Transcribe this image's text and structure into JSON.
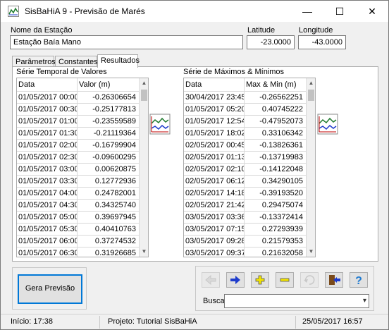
{
  "window": {
    "title": "SisBaHiA 9 - Previsão de Marés",
    "minimize": "—",
    "maximize": "☐",
    "close": "✕"
  },
  "station": {
    "name_label": "Nome da Estação",
    "name_value": "Estação Baía Mano",
    "lat_label": "Latitude",
    "lat_value": "-23.0000",
    "lon_label": "Longitude",
    "lon_value": "-43.0000"
  },
  "tabs": [
    {
      "label": "Parâmetros"
    },
    {
      "label": "Constantes"
    },
    {
      "label": "Resultados"
    }
  ],
  "series": {
    "title": "Série Temporal de Valores",
    "col1": "Data",
    "col2": "Valor (m)",
    "rows": [
      [
        "01/05/2017 00:00",
        "-0.26306654"
      ],
      [
        "01/05/2017 00:30",
        "-0.25177813"
      ],
      [
        "01/05/2017 01:00",
        "-0.23559589"
      ],
      [
        "01/05/2017 01:30",
        "-0.21119364"
      ],
      [
        "01/05/2017 02:00",
        "-0.16799904"
      ],
      [
        "01/05/2017 02:30",
        "-0.09600295"
      ],
      [
        "01/05/2017 03:00",
        "0.00620875"
      ],
      [
        "01/05/2017 03:30",
        "0.12772936"
      ],
      [
        "01/05/2017 04:00",
        "0.24782001"
      ],
      [
        "01/05/2017 04:30",
        "0.34325740"
      ],
      [
        "01/05/2017 05:00",
        "0.39697945"
      ],
      [
        "01/05/2017 05:30",
        "0.40410763"
      ],
      [
        "01/05/2017 06:00",
        "0.37274532"
      ],
      [
        "01/05/2017 06:30",
        "0.31926685"
      ]
    ]
  },
  "extremes": {
    "title": "Série de Máximos & Mínimos",
    "col1": "Data",
    "col2": "Max & Min (m)",
    "rows": [
      [
        "30/04/2017 23:45",
        "-0.26562251"
      ],
      [
        "01/05/2017 05:20",
        "0.40745222"
      ],
      [
        "01/05/2017 12:54",
        "-0.47952073"
      ],
      [
        "01/05/2017 18:02",
        "0.33106342"
      ],
      [
        "02/05/2017 00:45",
        "-0.13826361"
      ],
      [
        "02/05/2017 01:13",
        "-0.13719983"
      ],
      [
        "02/05/2017 02:10",
        "-0.14122048"
      ],
      [
        "02/05/2017 06:12",
        "0.34290105"
      ],
      [
        "02/05/2017 14:18",
        "-0.39193520"
      ],
      [
        "02/05/2017 21:42",
        "0.29475074"
      ],
      [
        "03/05/2017 03:36",
        "-0.13372414"
      ],
      [
        "03/05/2017 07:15",
        "0.27293939"
      ],
      [
        "03/05/2017 09:28",
        "0.21579353"
      ],
      [
        "03/05/2017 09:37",
        "0.21632058"
      ]
    ]
  },
  "actions": {
    "gera_label": "Gera Previsão",
    "busca_label": "Busca:",
    "busca_value": "",
    "help": "?"
  },
  "status": {
    "inicio": "Início: 17:38",
    "projeto": "Projeto: Tutorial SisBaHiA",
    "datetime": "25/05/2017 16:57"
  },
  "colors": {
    "accent": "#0078d7",
    "nav_arrow": "#1e3ccc",
    "nav_yellow": "#f2e400"
  }
}
